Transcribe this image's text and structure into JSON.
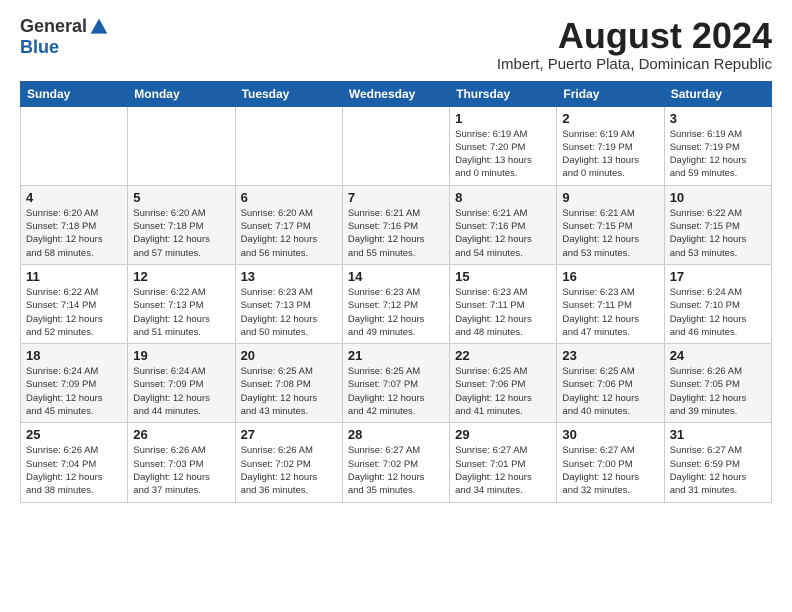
{
  "logo": {
    "general": "General",
    "blue": "Blue"
  },
  "title": {
    "month": "August 2024",
    "location": "Imbert, Puerto Plata, Dominican Republic"
  },
  "calendar": {
    "headers": [
      "Sunday",
      "Monday",
      "Tuesday",
      "Wednesday",
      "Thursday",
      "Friday",
      "Saturday"
    ],
    "weeks": [
      [
        {
          "day": "",
          "info": ""
        },
        {
          "day": "",
          "info": ""
        },
        {
          "day": "",
          "info": ""
        },
        {
          "day": "",
          "info": ""
        },
        {
          "day": "1",
          "info": "Sunrise: 6:19 AM\nSunset: 7:20 PM\nDaylight: 13 hours\nand 0 minutes."
        },
        {
          "day": "2",
          "info": "Sunrise: 6:19 AM\nSunset: 7:19 PM\nDaylight: 13 hours\nand 0 minutes."
        },
        {
          "day": "3",
          "info": "Sunrise: 6:19 AM\nSunset: 7:19 PM\nDaylight: 12 hours\nand 59 minutes."
        }
      ],
      [
        {
          "day": "4",
          "info": "Sunrise: 6:20 AM\nSunset: 7:18 PM\nDaylight: 12 hours\nand 58 minutes."
        },
        {
          "day": "5",
          "info": "Sunrise: 6:20 AM\nSunset: 7:18 PM\nDaylight: 12 hours\nand 57 minutes."
        },
        {
          "day": "6",
          "info": "Sunrise: 6:20 AM\nSunset: 7:17 PM\nDaylight: 12 hours\nand 56 minutes."
        },
        {
          "day": "7",
          "info": "Sunrise: 6:21 AM\nSunset: 7:16 PM\nDaylight: 12 hours\nand 55 minutes."
        },
        {
          "day": "8",
          "info": "Sunrise: 6:21 AM\nSunset: 7:16 PM\nDaylight: 12 hours\nand 54 minutes."
        },
        {
          "day": "9",
          "info": "Sunrise: 6:21 AM\nSunset: 7:15 PM\nDaylight: 12 hours\nand 53 minutes."
        },
        {
          "day": "10",
          "info": "Sunrise: 6:22 AM\nSunset: 7:15 PM\nDaylight: 12 hours\nand 53 minutes."
        }
      ],
      [
        {
          "day": "11",
          "info": "Sunrise: 6:22 AM\nSunset: 7:14 PM\nDaylight: 12 hours\nand 52 minutes."
        },
        {
          "day": "12",
          "info": "Sunrise: 6:22 AM\nSunset: 7:13 PM\nDaylight: 12 hours\nand 51 minutes."
        },
        {
          "day": "13",
          "info": "Sunrise: 6:23 AM\nSunset: 7:13 PM\nDaylight: 12 hours\nand 50 minutes."
        },
        {
          "day": "14",
          "info": "Sunrise: 6:23 AM\nSunset: 7:12 PM\nDaylight: 12 hours\nand 49 minutes."
        },
        {
          "day": "15",
          "info": "Sunrise: 6:23 AM\nSunset: 7:11 PM\nDaylight: 12 hours\nand 48 minutes."
        },
        {
          "day": "16",
          "info": "Sunrise: 6:23 AM\nSunset: 7:11 PM\nDaylight: 12 hours\nand 47 minutes."
        },
        {
          "day": "17",
          "info": "Sunrise: 6:24 AM\nSunset: 7:10 PM\nDaylight: 12 hours\nand 46 minutes."
        }
      ],
      [
        {
          "day": "18",
          "info": "Sunrise: 6:24 AM\nSunset: 7:09 PM\nDaylight: 12 hours\nand 45 minutes."
        },
        {
          "day": "19",
          "info": "Sunrise: 6:24 AM\nSunset: 7:09 PM\nDaylight: 12 hours\nand 44 minutes."
        },
        {
          "day": "20",
          "info": "Sunrise: 6:25 AM\nSunset: 7:08 PM\nDaylight: 12 hours\nand 43 minutes."
        },
        {
          "day": "21",
          "info": "Sunrise: 6:25 AM\nSunset: 7:07 PM\nDaylight: 12 hours\nand 42 minutes."
        },
        {
          "day": "22",
          "info": "Sunrise: 6:25 AM\nSunset: 7:06 PM\nDaylight: 12 hours\nand 41 minutes."
        },
        {
          "day": "23",
          "info": "Sunrise: 6:25 AM\nSunset: 7:06 PM\nDaylight: 12 hours\nand 40 minutes."
        },
        {
          "day": "24",
          "info": "Sunrise: 6:26 AM\nSunset: 7:05 PM\nDaylight: 12 hours\nand 39 minutes."
        }
      ],
      [
        {
          "day": "25",
          "info": "Sunrise: 6:26 AM\nSunset: 7:04 PM\nDaylight: 12 hours\nand 38 minutes."
        },
        {
          "day": "26",
          "info": "Sunrise: 6:26 AM\nSunset: 7:03 PM\nDaylight: 12 hours\nand 37 minutes."
        },
        {
          "day": "27",
          "info": "Sunrise: 6:26 AM\nSunset: 7:02 PM\nDaylight: 12 hours\nand 36 minutes."
        },
        {
          "day": "28",
          "info": "Sunrise: 6:27 AM\nSunset: 7:02 PM\nDaylight: 12 hours\nand 35 minutes."
        },
        {
          "day": "29",
          "info": "Sunrise: 6:27 AM\nSunset: 7:01 PM\nDaylight: 12 hours\nand 34 minutes."
        },
        {
          "day": "30",
          "info": "Sunrise: 6:27 AM\nSunset: 7:00 PM\nDaylight: 12 hours\nand 32 minutes."
        },
        {
          "day": "31",
          "info": "Sunrise: 6:27 AM\nSunset: 6:59 PM\nDaylight: 12 hours\nand 31 minutes."
        }
      ]
    ]
  }
}
